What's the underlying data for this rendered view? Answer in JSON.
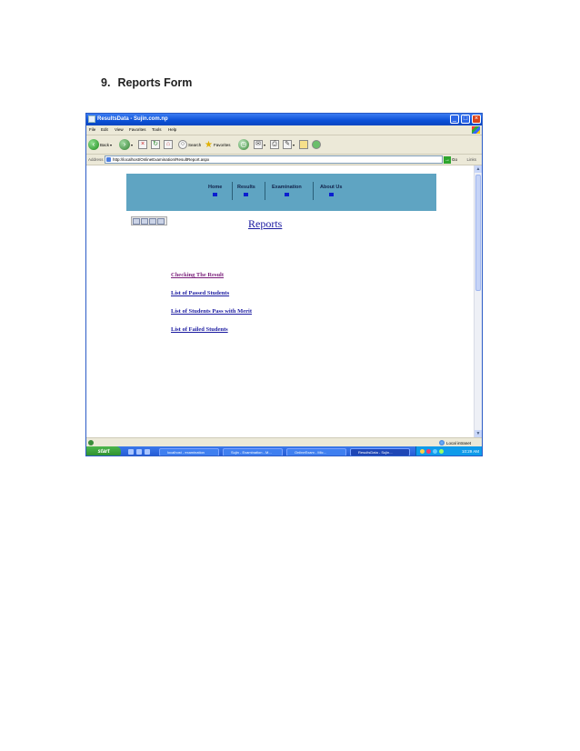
{
  "heading": {
    "number": "9.",
    "text": "Reports Form"
  },
  "window": {
    "title": "ResultsData - Sujin.com.np",
    "menu": [
      "File",
      "Edit",
      "View",
      "Favorites",
      "Tools",
      "Help"
    ],
    "toolbar": {
      "back": "Back",
      "search": "Search",
      "favorites": "Favorites"
    },
    "address": {
      "label": "Address",
      "url": "http://localhost/OnlineExamination/ResultReport.aspx",
      "go": "Go",
      "links": "Links"
    }
  },
  "page": {
    "nav": [
      "Home",
      "Results",
      "Examination",
      "About Us"
    ],
    "title": "Reports",
    "links": [
      {
        "label": "Checking The Result",
        "visited": true
      },
      {
        "label": "List of Passed Students",
        "visited": false
      },
      {
        "label": "List of Students Pass with Merit",
        "visited": false
      },
      {
        "label": "List of Failed Students",
        "visited": false
      }
    ]
  },
  "status": {
    "zone": "Local intranet"
  },
  "taskbar": {
    "start": "start",
    "tasks": [
      "localhost - examination",
      "Sujin - Examination - M...",
      "OnlineExam - Mic...",
      "ResultsData - Sujin..."
    ],
    "clock": "10:29 AM"
  },
  "colors": {
    "nav_band": "#5fa4c2",
    "link": "#1a1aa0",
    "visited_link": "#7a1f7a",
    "nav_marker": "#0b1fcf"
  }
}
